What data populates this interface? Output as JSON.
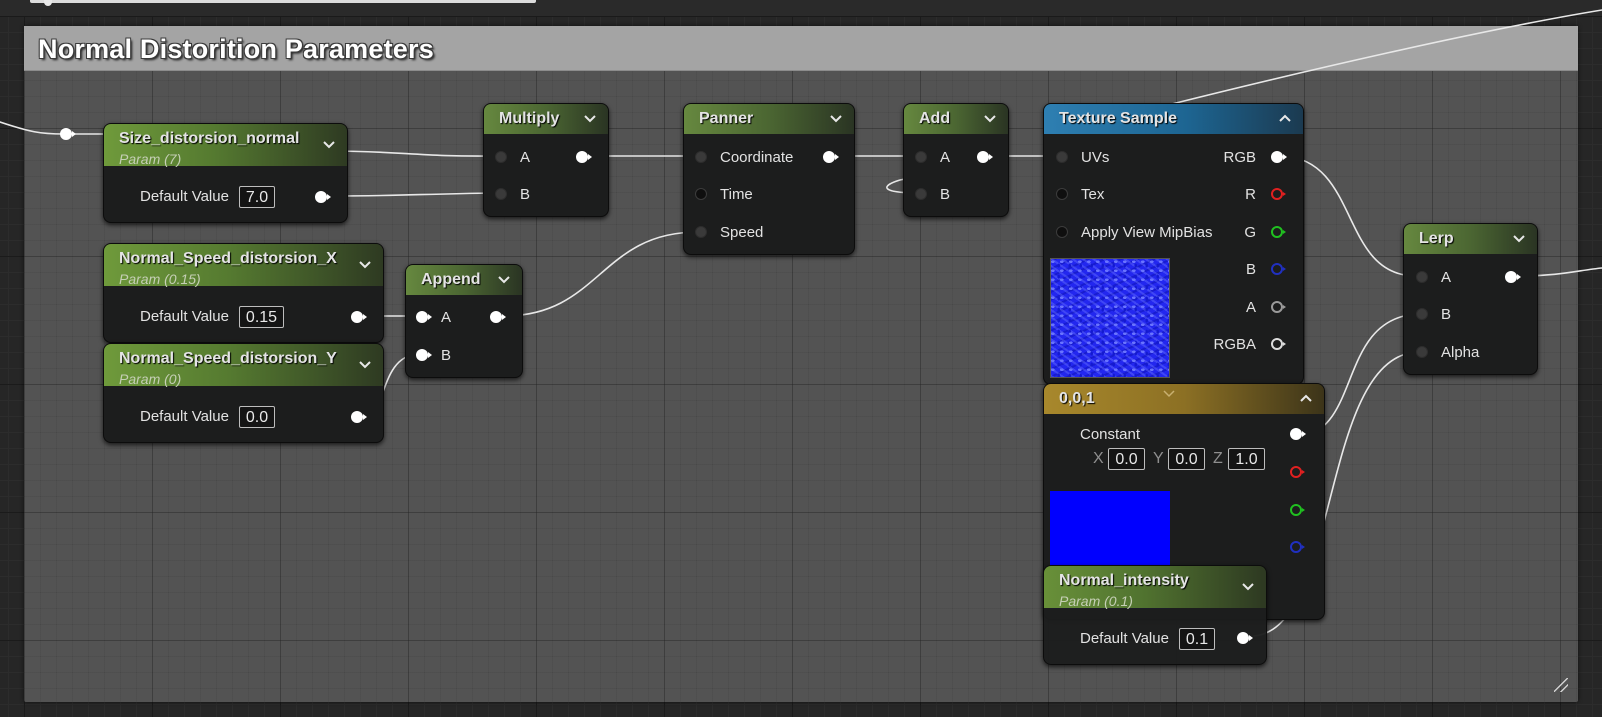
{
  "comment": {
    "title": "Normal Distorition Parameters"
  },
  "colors": {
    "param_header": "#6f9a3b",
    "function_header": "#557a30",
    "texture_header": "#2e7fb2",
    "constant_header": "#a8882c",
    "pin_r": "#e02020",
    "pin_g": "#20c020",
    "pin_b": "#2030c0",
    "pin_a": "#9a9a9a",
    "wire": "#e8e8e8"
  },
  "nodes": {
    "size_param": {
      "title": "Size_distorsion_normal",
      "subtitle": "Param (7)",
      "default_label": "Default Value",
      "default_value": "7.0"
    },
    "speed_x": {
      "title": "Normal_Speed_distorsion_X",
      "subtitle": "Param (0.15)",
      "default_label": "Default Value",
      "default_value": "0.15"
    },
    "speed_y": {
      "title": "Normal_Speed_distorsion_Y",
      "subtitle": "Param (0)",
      "default_label": "Default Value",
      "default_value": "0.0"
    },
    "multiply": {
      "title": "Multiply",
      "pin_a": "A",
      "pin_b": "B"
    },
    "append": {
      "title": "Append",
      "pin_a": "A",
      "pin_b": "B"
    },
    "panner": {
      "title": "Panner",
      "pin_coordinate": "Coordinate",
      "pin_time": "Time",
      "pin_speed": "Speed"
    },
    "add": {
      "title": "Add",
      "pin_a": "A",
      "pin_b": "B"
    },
    "texture_sample": {
      "title": "Texture Sample",
      "pin_uvs": "UVs",
      "pin_tex": "Tex",
      "pin_mipbias": "Apply View MipBias",
      "out_rgb": "RGB",
      "out_r": "R",
      "out_g": "G",
      "out_b": "B",
      "out_a": "A",
      "out_rgba": "RGBA"
    },
    "constant3": {
      "title": "0,0,1",
      "output_label": "Constant",
      "x_label": "X",
      "x_value": "0.0",
      "y_label": "Y",
      "y_value": "0.0",
      "z_label": "Z",
      "z_value": "1.0"
    },
    "lerp": {
      "title": "Lerp",
      "pin_a": "A",
      "pin_b": "B",
      "pin_alpha": "Alpha"
    },
    "intensity": {
      "title": "Normal_intensity",
      "subtitle": "Param (0.1)",
      "default_label": "Default Value",
      "default_value": "0.1"
    }
  }
}
